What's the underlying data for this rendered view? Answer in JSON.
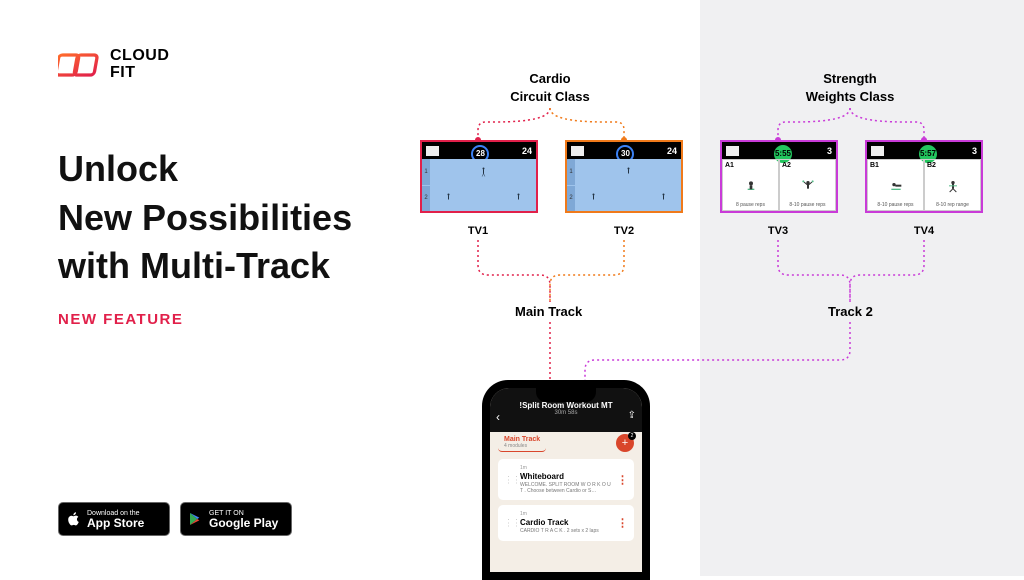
{
  "brand": {
    "line1": "CLOUD",
    "line2": "FIT"
  },
  "headline": {
    "line1": "Unlock",
    "line2": "New Possibilities",
    "line3": "with Multi-Track",
    "badge": "NEW FEATURE"
  },
  "stores": {
    "apple_top": "Download on the",
    "apple_bottom": "App Store",
    "google_top": "GET IT ON",
    "google_bottom": "Google Play"
  },
  "diagram": {
    "class_cardio_line1": "Cardio",
    "class_cardio_line2": "Circuit Class",
    "class_strength_line1": "Strength",
    "class_strength_line2": "Weights Class",
    "track_main": "Main Track",
    "track_2": "Track 2",
    "tvs": {
      "tv1": {
        "label": "TV1",
        "timer": "28",
        "right": "24"
      },
      "tv2": {
        "label": "TV2",
        "timer": "30",
        "right": "24"
      },
      "tv3": {
        "label": "TV3",
        "timer": "5:55",
        "right": "3",
        "cellA": "A1",
        "cellB": "A2",
        "subA": "8 pause reps",
        "subB": "8-10 pause reps"
      },
      "tv4": {
        "label": "TV4",
        "timer": "5:57",
        "right": "3",
        "cellA": "B1",
        "cellB": "B2",
        "subA": "8-10 pause reps",
        "subB": "8-10 rep range"
      }
    }
  },
  "phone": {
    "title": "!Split Room Workout MT",
    "subtitle": "30m 58s",
    "tab_main": "Main Track",
    "tab_main_sub": "4 modules",
    "plus_badge": "2",
    "cards": [
      {
        "tag": "1m",
        "title": "Whiteboard",
        "desc": "WELCOME. SPLIT ROOM W O R K O U T . Choose between Cardio or S…"
      },
      {
        "tag": "1m",
        "title": "Cardio Track",
        "desc": "CARDIO T R A C K . 2 sets x 2 laps"
      }
    ]
  },
  "colors": {
    "red": "#e1204a",
    "orange": "#f07a1a",
    "magenta": "#c93bd8"
  }
}
